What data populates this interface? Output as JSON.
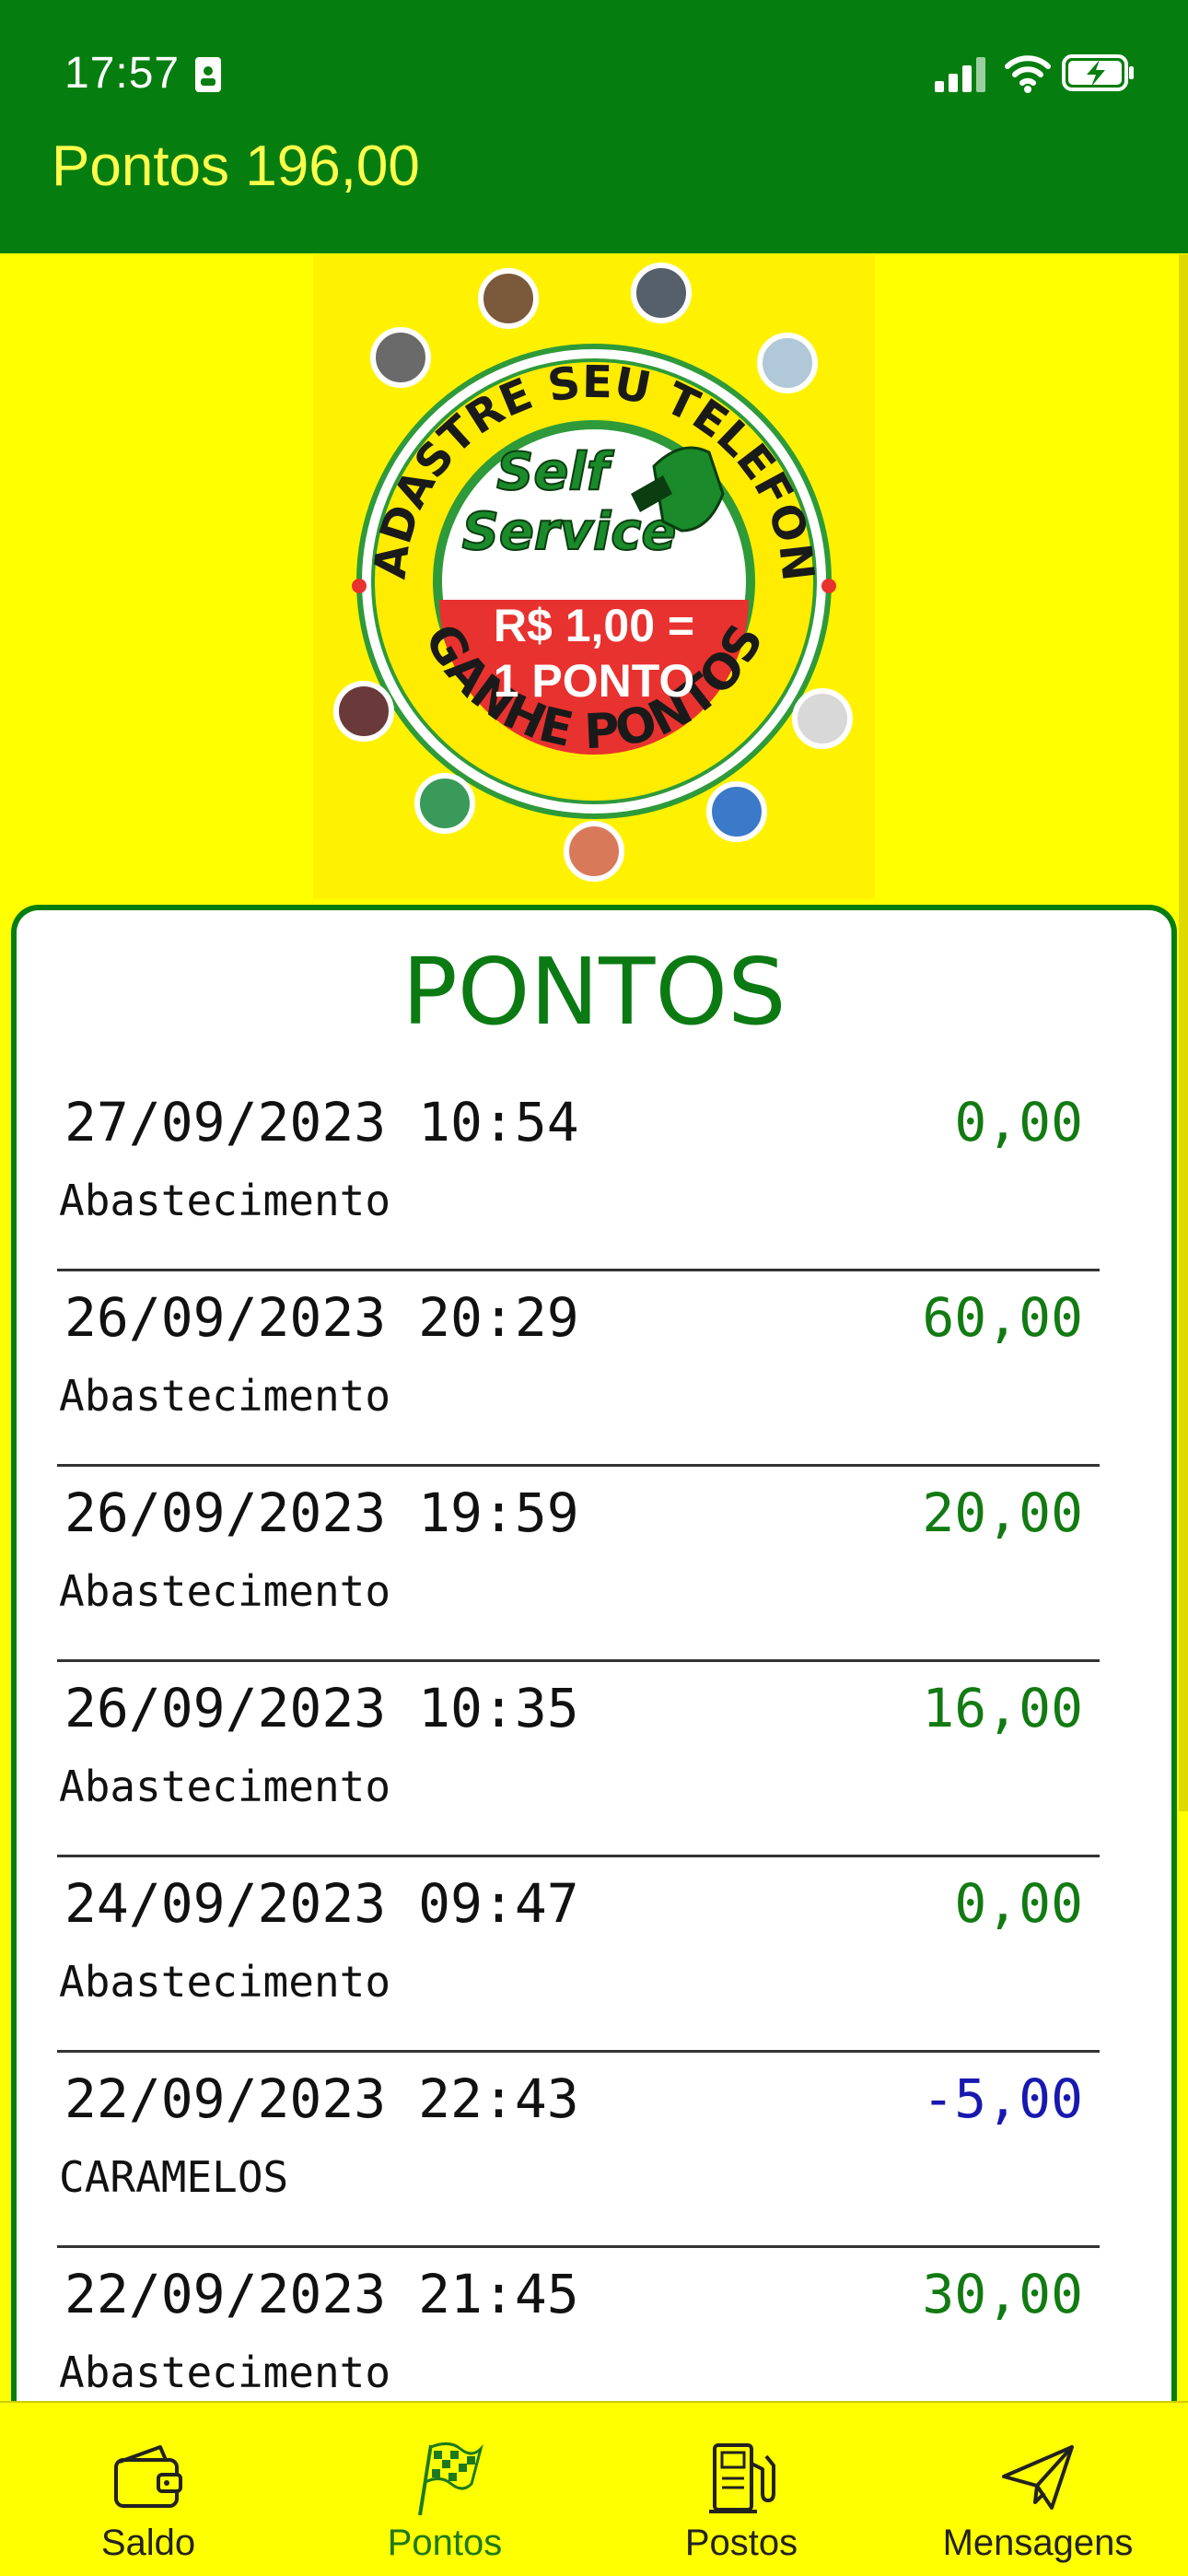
{
  "status_bar": {
    "time": "17:57"
  },
  "header": {
    "title": "Pontos 196,00"
  },
  "banner": {
    "arc_text_top": "CADASTRE SEU TELEFONE",
    "arc_text_bottom": "GANHE PONTOS",
    "center_line1": "Self",
    "center_line2": "Service",
    "rate_line1": "R$ 1,00 =",
    "rate_line2": "1 PONTO"
  },
  "card": {
    "title": "PONTOS",
    "rows": [
      {
        "date": "27/09/2023 10:54",
        "value": "0,00",
        "desc": "Abastecimento"
      },
      {
        "date": "26/09/2023 20:29",
        "value": "60,00",
        "desc": "Abastecimento"
      },
      {
        "date": "26/09/2023 19:59",
        "value": "20,00",
        "desc": "Abastecimento"
      },
      {
        "date": "26/09/2023 10:35",
        "value": "16,00",
        "desc": "Abastecimento"
      },
      {
        "date": "24/09/2023 09:47",
        "value": "0,00",
        "desc": "Abastecimento"
      },
      {
        "date": "22/09/2023 22:43",
        "value": "-5,00",
        "desc": "CARAMELOS"
      },
      {
        "date": "22/09/2023 21:45",
        "value": "30,00",
        "desc": "Abastecimento"
      }
    ]
  },
  "nav": {
    "items": [
      {
        "label": "Saldo",
        "icon": "wallet-icon"
      },
      {
        "label": "Pontos",
        "icon": "checkered-flag-icon",
        "active": true
      },
      {
        "label": "Postos",
        "icon": "fuel-pump-icon"
      },
      {
        "label": "Mensagens",
        "icon": "paper-plane-icon"
      }
    ]
  },
  "colors": {
    "header_green": "#067e0f",
    "background_yellow": "#ffff00",
    "positive_value": "#127a12",
    "negative_value": "#1818b0"
  }
}
